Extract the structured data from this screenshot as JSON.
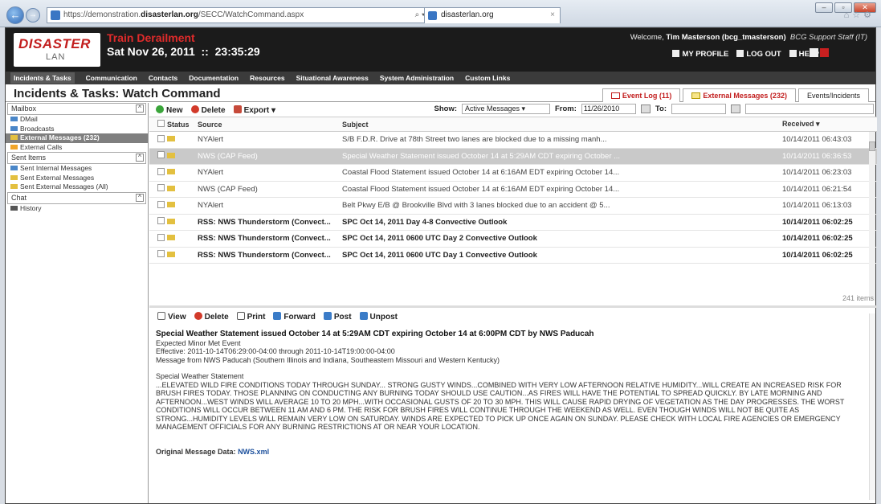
{
  "browser": {
    "url_prefix": "https://demonstration.",
    "url_domain": "disasterlan.org",
    "url_path": "/SECC/WatchCommand.aspx",
    "address_controls": "⌕ ▾ ⓘ ↻ ✕",
    "tab_label": "disasterlan.org"
  },
  "header": {
    "logo_main": "DISASTER",
    "logo_sub": "LAN",
    "title": "Train Derailment",
    "datetime": "Sat Nov 26, 2011  ::  23:35:29",
    "welcome_prefix": "Welcome, ",
    "welcome_user": "Tim Masterson (bcg_tmasterson)",
    "welcome_role": "BCG Support Staff (IT)",
    "links": [
      "MY PROFILE",
      "LOG OUT",
      "HELP"
    ]
  },
  "menu": [
    "Incidents & Tasks",
    "Communication",
    "Contacts",
    "Documentation",
    "Resources",
    "Situational Awareness",
    "System Administration",
    "Custom Links"
  ],
  "page": {
    "title": "Incidents & Tasks: Watch Command",
    "right_tabs": [
      "Event Log (11)",
      "External Messages (232)",
      "Events/Incidents"
    ]
  },
  "sidebar": {
    "mailbox_label": "Mailbox",
    "mailbox_items": [
      "DMail",
      "Broadcasts",
      "External Messages (232)",
      "External Calls"
    ],
    "sent_label": "Sent Items",
    "sent_items": [
      "Sent Internal Messages",
      "Sent External Messages",
      "Sent External Messages (All)"
    ],
    "chat_label": "Chat",
    "chat_items": [
      "History"
    ]
  },
  "toolbar": {
    "new": "New",
    "delete": "Delete",
    "export": "Export ▾",
    "show_label": "Show:",
    "show_value": "Active Messages",
    "from_label": "From:",
    "from_value": "11/26/2010",
    "to_label": "To:",
    "to_value": ""
  },
  "grid": {
    "headers": {
      "status": "Status",
      "source": "Source",
      "subject": "Subject",
      "received": "Received ▾"
    },
    "rows": [
      {
        "source": "NYAlert",
        "subject": "S/B F.D.R. Drive at 78th Street two lanes are blocked due to a missing manh...",
        "received": "10/14/2011 06:43:03"
      },
      {
        "source": "NWS (CAP Feed)",
        "subject": "Special Weather Statement issued October 14 at 5:29AM CDT expiring October ...",
        "received": "10/14/2011 06:36:53"
      },
      {
        "source": "NYAlert",
        "subject": "Coastal Flood Statement issued October 14 at 6:16AM EDT expiring October 14...",
        "received": "10/14/2011 06:23:03"
      },
      {
        "source": "NWS (CAP Feed)",
        "subject": "Coastal Flood Statement issued October 14 at 6:16AM EDT expiring October 14...",
        "received": "10/14/2011 06:21:54"
      },
      {
        "source": "NYAlert",
        "subject": "Belt Pkwy E/B @ Brookville Blvd with 3 lanes blocked due to an accident @ 5...",
        "received": "10/14/2011 06:13:03"
      },
      {
        "source": "RSS: NWS Thunderstorm (Convect...",
        "subject": "SPC Oct 14, 2011 Day 4-8 Convective Outlook",
        "received": "10/14/2011 06:02:25"
      },
      {
        "source": "RSS: NWS Thunderstorm (Convect...",
        "subject": "SPC Oct 14, 2011 0600 UTC Day 2 Convective Outlook",
        "received": "10/14/2011 06:02:25"
      },
      {
        "source": "RSS: NWS Thunderstorm (Convect...",
        "subject": "SPC Oct 14, 2011 0600 UTC Day 1 Convective Outlook",
        "received": "10/14/2011 06:02:25"
      }
    ],
    "count": "241 items"
  },
  "preview_toolbar": [
    "View",
    "Delete",
    "Print",
    "Forward",
    "Post",
    "Unpost"
  ],
  "preview": {
    "title": "Special Weather Statement issued October 14 at 5:29AM CDT expiring October 14 at 6:00PM CDT by NWS Paducah",
    "line1": "Expected Minor Met Event",
    "line2": "Effective: 2011-10-14T06:29:00-04:00 through 2011-10-14T19:00:00-04:00",
    "line3": "Message from NWS Paducah (Southern Illinois and Indiana, Southeastern Missouri and Western Kentucky)",
    "body_title": "Special Weather Statement",
    "body": "...ELEVATED WILD FIRE CONDITIONS TODAY THROUGH SUNDAY... STRONG GUSTY WINDS...COMBINED WITH VERY LOW AFTERNOON RELATIVE HUMIDITY...WILL CREATE AN INCREASED RISK FOR BRUSH FIRES TODAY. THOSE PLANNING ON CONDUCTING ANY BURNING TODAY SHOULD USE CAUTION...AS FIRES WILL HAVE THE POTENTIAL TO SPREAD QUICKLY. BY LATE MORNING AND AFTERNOON...WEST WINDS WILL AVERAGE 10 TO 20 MPH...WITH OCCASIONAL GUSTS OF 20 TO 30 MPH. THIS WILL CAUSE RAPID DRYING OF VEGETATION AS THE DAY PROGRESSES. THE WORST CONDITIONS WILL OCCUR BETWEEN 11 AM AND 6 PM. THE RISK FOR BRUSH FIRES WILL CONTINUE THROUGH THE WEEKEND AS WELL. EVEN THOUGH WINDS WILL NOT BE QUITE AS STRONG...HUMIDITY LEVELS WILL REMAIN VERY LOW ON SATURDAY. WINDS ARE EXPECTED TO PICK UP ONCE AGAIN ON SUNDAY. PLEASE CHECK WITH LOCAL FIRE AGENCIES OR EMERGENCY MANAGEMENT OFFICIALS FOR ANY BURNING RESTRICTIONS AT OR NEAR YOUR LOCATION.",
    "orig_label": "Original Message Data:",
    "orig_link": "NWS.xml"
  },
  "colors": {
    "brand_red": "#c21d1d",
    "highlight_row": "#c9c9c9",
    "accent_blue": "#1b4f9c"
  }
}
